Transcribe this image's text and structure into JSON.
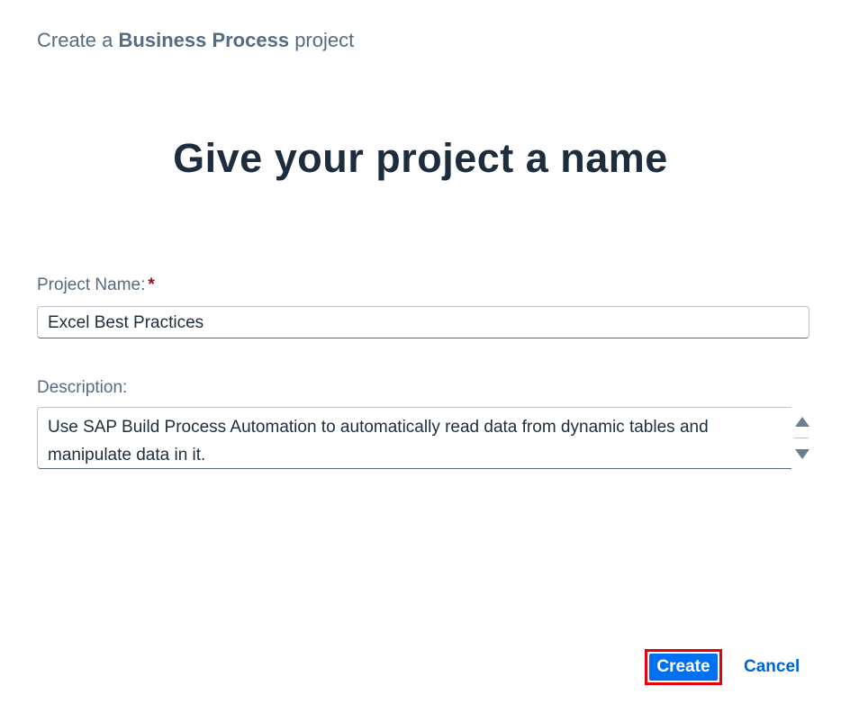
{
  "header": {
    "prefix": "Create a",
    "emphasis": "Business Process",
    "suffix": "project"
  },
  "title": "Give your project a name",
  "form": {
    "project_name": {
      "label": "Project Name:",
      "required_marker": "*",
      "value": "Excel Best Practices"
    },
    "description": {
      "label": "Description:",
      "value": "Use SAP Build Process Automation to automatically read data from dynamic tables and manipulate data in it."
    }
  },
  "actions": {
    "create_label": "Create",
    "cancel_label": "Cancel"
  },
  "colors": {
    "primary_button": "#0070f2",
    "highlight_border": "#e3000f",
    "link": "#0064d9",
    "title_text": "#1d2d3e",
    "label_text": "#556b82"
  },
  "icons": {
    "scroll_up": "triangle-up-icon",
    "scroll_down": "triangle-down-icon"
  }
}
